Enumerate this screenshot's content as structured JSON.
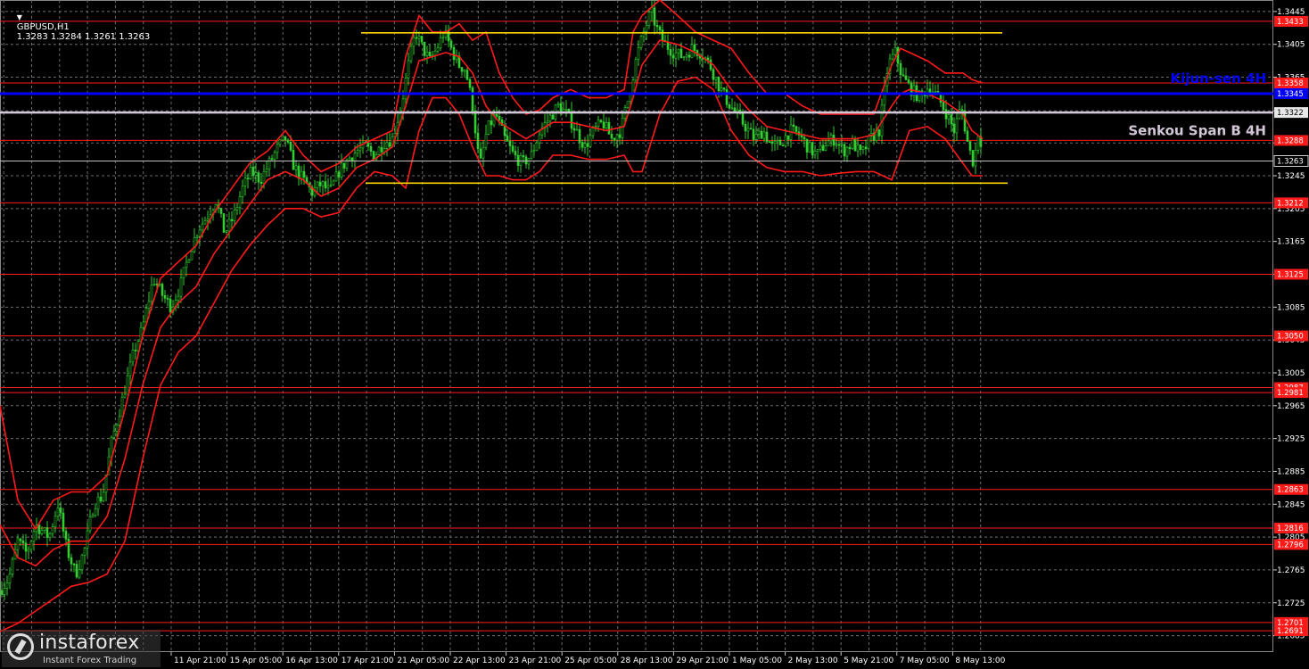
{
  "header": {
    "symbol": "GBPUSD,H1",
    "ohlc": "1.3283 1.3284 1.3261 1.3263"
  },
  "watermark": {
    "brand": "instaforex",
    "subtitle": "Instant Forex Trading"
  },
  "colors": {
    "background": "#000000",
    "grid": "#6d6d6d",
    "bull": "#32cd32",
    "bear": "#32cd32",
    "level": "#ff1a1a",
    "channel": "#ffd700",
    "kijun": "#0000ff",
    "senkou": "#d3c6d6",
    "axis_text": "#ffffff"
  },
  "chart_data": {
    "type": "candlestick",
    "symbol": "GBPUSD",
    "timeframe": "H1",
    "ylim": [
      1.2665,
      1.3459
    ],
    "grid": true,
    "y_ticks": [
      "1.3445",
      "1.3405",
      "1.3365",
      "1.3324",
      "1.3285",
      "1.3245",
      "1.3205",
      "1.3165",
      "1.3125",
      "1.3085",
      "1.3045",
      "1.3005",
      "1.2965",
      "1.2925",
      "1.2885",
      "1.2845",
      "1.2805",
      "1.2765",
      "1.2725",
      "1.2685"
    ],
    "x_ticks": [
      "11 Apr 21:00",
      "15 Apr 05:00",
      "16 Apr 13:00",
      "17 Apr 21:00",
      "21 Apr 05:00",
      "22 Apr 13:00",
      "23 Apr 21:00",
      "25 Apr 05:00",
      "28 Apr 13:00",
      "29 Apr 21:00",
      "1 May 05:00",
      "2 May 13:00",
      "5 May 21:00",
      "7 May 05:00",
      "8 May 13:00"
    ],
    "price_levels": [
      {
        "label": "1.3433",
        "value": 1.3433
      },
      {
        "label": "1.3358",
        "value": 1.3358
      },
      {
        "label": "1.3288",
        "value": 1.3288
      },
      {
        "label": "1.3212",
        "value": 1.3212
      },
      {
        "label": "1.3125",
        "value": 1.3125
      },
      {
        "label": "1.3050",
        "value": 1.305
      },
      {
        "label": "1.2987",
        "value": 1.2987
      },
      {
        "label": "1.2981",
        "value": 1.2981
      },
      {
        "label": "1.2863",
        "value": 1.2863
      },
      {
        "label": "1.2816",
        "value": 1.2816
      },
      {
        "label": "1.2796",
        "value": 1.2796
      },
      {
        "label": "1.2701",
        "value": 1.2701
      },
      {
        "label": "1.2691",
        "value": 1.2691
      }
    ],
    "current_price": {
      "label": "1.3263",
      "value": 1.3263
    },
    "kijun": {
      "name": "Kijun-sen 4H",
      "value": 1.3345,
      "label": "1.3345"
    },
    "senkou": {
      "name": "Senkou Span B 4H",
      "value": 1.3322,
      "label": "1.3322"
    },
    "channel": {
      "top": 1.3419,
      "bottom": 1.3236
    },
    "price_path": [
      [
        0,
        1.274
      ],
      [
        10,
        1.2755
      ],
      [
        20,
        1.28
      ],
      [
        30,
        1.2785
      ],
      [
        40,
        1.282
      ],
      [
        55,
        1.2805
      ],
      [
        65,
        1.2845
      ],
      [
        75,
        1.279
      ],
      [
        85,
        1.276
      ],
      [
        95,
        1.279
      ],
      [
        105,
        1.2845
      ],
      [
        115,
        1.2855
      ],
      [
        125,
        1.292
      ],
      [
        140,
        1.2985
      ],
      [
        150,
        1.303
      ],
      [
        160,
        1.306
      ],
      [
        172,
        1.312
      ],
      [
        182,
        1.31
      ],
      [
        192,
        1.3085
      ],
      [
        202,
        1.311
      ],
      [
        212,
        1.315
      ],
      [
        222,
        1.318
      ],
      [
        232,
        1.3195
      ],
      [
        242,
        1.3215
      ],
      [
        252,
        1.3175
      ],
      [
        262,
        1.3195
      ],
      [
        272,
        1.323
      ],
      [
        282,
        1.325
      ],
      [
        292,
        1.324
      ],
      [
        302,
        1.326
      ],
      [
        312,
        1.328
      ],
      [
        320,
        1.329
      ],
      [
        330,
        1.3255
      ],
      [
        340,
        1.324
      ],
      [
        350,
        1.3225
      ],
      [
        360,
        1.3235
      ],
      [
        370,
        1.3225
      ],
      [
        380,
        1.325
      ],
      [
        390,
        1.3265
      ],
      [
        400,
        1.3275
      ],
      [
        410,
        1.328
      ],
      [
        420,
        1.327
      ],
      [
        430,
        1.3285
      ],
      [
        440,
        1.329
      ],
      [
        450,
        1.333
      ],
      [
        458,
        1.338
      ],
      [
        466,
        1.342
      ],
      [
        474,
        1.34
      ],
      [
        482,
        1.3385
      ],
      [
        490,
        1.34
      ],
      [
        498,
        1.342
      ],
      [
        506,
        1.34
      ],
      [
        514,
        1.338
      ],
      [
        522,
        1.3375
      ],
      [
        530,
        1.333
      ],
      [
        538,
        1.3255
      ],
      [
        546,
        1.33
      ],
      [
        556,
        1.332
      ],
      [
        566,
        1.329
      ],
      [
        576,
        1.327
      ],
      [
        586,
        1.326
      ],
      [
        596,
        1.327
      ],
      [
        606,
        1.33
      ],
      [
        616,
        1.3315
      ],
      [
        626,
        1.333
      ],
      [
        636,
        1.332
      ],
      [
        646,
        1.33
      ],
      [
        656,
        1.328
      ],
      [
        666,
        1.33
      ],
      [
        676,
        1.331
      ],
      [
        686,
        1.329
      ],
      [
        696,
        1.33
      ],
      [
        706,
        1.3345
      ],
      [
        714,
        1.339
      ],
      [
        722,
        1.342
      ],
      [
        730,
        1.3445
      ],
      [
        738,
        1.342
      ],
      [
        746,
        1.3405
      ],
      [
        756,
        1.3395
      ],
      [
        766,
        1.339
      ],
      [
        776,
        1.34
      ],
      [
        786,
        1.3395
      ],
      [
        796,
        1.338
      ],
      [
        806,
        1.3355
      ],
      [
        816,
        1.3335
      ],
      [
        826,
        1.332
      ],
      [
        836,
        1.3305
      ],
      [
        846,
        1.329
      ],
      [
        856,
        1.33
      ],
      [
        866,
        1.328
      ],
      [
        876,
        1.3285
      ],
      [
        886,
        1.33
      ],
      [
        896,
        1.3295
      ],
      [
        906,
        1.328
      ],
      [
        916,
        1.327
      ],
      [
        926,
        1.3285
      ],
      [
        936,
        1.329
      ],
      [
        946,
        1.3275
      ],
      [
        956,
        1.3285
      ],
      [
        966,
        1.327
      ],
      [
        976,
        1.329
      ],
      [
        986,
        1.33
      ],
      [
        996,
        1.338
      ],
      [
        1004,
        1.3395
      ],
      [
        1012,
        1.3365
      ],
      [
        1022,
        1.335
      ],
      [
        1032,
        1.334
      ],
      [
        1042,
        1.3355
      ],
      [
        1052,
        1.334
      ],
      [
        1062,
        1.332
      ],
      [
        1070,
        1.33
      ],
      [
        1078,
        1.333
      ],
      [
        1086,
        1.328
      ],
      [
        1092,
        1.326
      ],
      [
        1098,
        1.3305
      ],
      [
        1102,
        1.327
      ]
    ],
    "envelope_upper": [
      [
        0,
        1.2965
      ],
      [
        20,
        1.285
      ],
      [
        40,
        1.2815
      ],
      [
        60,
        1.285
      ],
      [
        80,
        1.286
      ],
      [
        100,
        1.286
      ],
      [
        120,
        1.288
      ],
      [
        140,
        1.296
      ],
      [
        160,
        1.305
      ],
      [
        180,
        1.312
      ],
      [
        200,
        1.314
      ],
      [
        220,
        1.316
      ],
      [
        240,
        1.32
      ],
      [
        260,
        1.323
      ],
      [
        280,
        1.326
      ],
      [
        300,
        1.3275
      ],
      [
        320,
        1.33
      ],
      [
        340,
        1.327
      ],
      [
        360,
        1.325
      ],
      [
        380,
        1.326
      ],
      [
        400,
        1.328
      ],
      [
        420,
        1.329
      ],
      [
        440,
        1.33
      ],
      [
        455,
        1.339
      ],
      [
        470,
        1.344
      ],
      [
        485,
        1.342
      ],
      [
        500,
        1.342
      ],
      [
        515,
        1.343
      ],
      [
        530,
        1.341
      ],
      [
        545,
        1.342
      ],
      [
        560,
        1.337
      ],
      [
        575,
        1.334
      ],
      [
        590,
        1.332
      ],
      [
        605,
        1.3325
      ],
      [
        620,
        1.334
      ],
      [
        640,
        1.335
      ],
      [
        660,
        1.334
      ],
      [
        680,
        1.334
      ],
      [
        700,
        1.335
      ],
      [
        710,
        1.342
      ],
      [
        720,
        1.344
      ],
      [
        740,
        1.3459
      ],
      [
        760,
        1.344
      ],
      [
        780,
        1.342
      ],
      [
        800,
        1.341
      ],
      [
        820,
        1.34
      ],
      [
        840,
        1.337
      ],
      [
        860,
        1.3345
      ],
      [
        880,
        1.3345
      ],
      [
        900,
        1.333
      ],
      [
        920,
        1.332
      ],
      [
        940,
        1.332
      ],
      [
        960,
        1.332
      ],
      [
        980,
        1.332
      ],
      [
        1000,
        1.338
      ],
      [
        1010,
        1.34
      ],
      [
        1020,
        1.3395
      ],
      [
        1040,
        1.3385
      ],
      [
        1060,
        1.337
      ],
      [
        1080,
        1.337
      ],
      [
        1090,
        1.3362
      ],
      [
        1102,
        1.3358
      ]
    ],
    "envelope_middle": [
      [
        0,
        1.282
      ],
      [
        20,
        1.278
      ],
      [
        40,
        1.277
      ],
      [
        60,
        1.279
      ],
      [
        80,
        1.28
      ],
      [
        100,
        1.28
      ],
      [
        120,
        1.283
      ],
      [
        140,
        1.29
      ],
      [
        160,
        1.299
      ],
      [
        180,
        1.306
      ],
      [
        200,
        1.309
      ],
      [
        220,
        1.311
      ],
      [
        240,
        1.315
      ],
      [
        260,
        1.318
      ],
      [
        280,
        1.321
      ],
      [
        300,
        1.324
      ],
      [
        320,
        1.325
      ],
      [
        340,
        1.324
      ],
      [
        360,
        1.322
      ],
      [
        380,
        1.323
      ],
      [
        400,
        1.3255
      ],
      [
        420,
        1.3265
      ],
      [
        440,
        1.328
      ],
      [
        455,
        1.333
      ],
      [
        470,
        1.3385
      ],
      [
        485,
        1.339
      ],
      [
        500,
        1.3395
      ],
      [
        515,
        1.339
      ],
      [
        530,
        1.337
      ],
      [
        545,
        1.333
      ],
      [
        560,
        1.331
      ],
      [
        575,
        1.33
      ],
      [
        590,
        1.329
      ],
      [
        605,
        1.33
      ],
      [
        620,
        1.331
      ],
      [
        640,
        1.331
      ],
      [
        660,
        1.3305
      ],
      [
        680,
        1.33
      ],
      [
        700,
        1.3305
      ],
      [
        710,
        1.334
      ],
      [
        720,
        1.338
      ],
      [
        740,
        1.341
      ],
      [
        760,
        1.3405
      ],
      [
        780,
        1.3395
      ],
      [
        800,
        1.338
      ],
      [
        820,
        1.335
      ],
      [
        840,
        1.3325
      ],
      [
        860,
        1.3305
      ],
      [
        880,
        1.33
      ],
      [
        900,
        1.3295
      ],
      [
        920,
        1.329
      ],
      [
        940,
        1.329
      ],
      [
        960,
        1.329
      ],
      [
        980,
        1.3295
      ],
      [
        1000,
        1.333
      ],
      [
        1010,
        1.3345
      ],
      [
        1020,
        1.335
      ],
      [
        1040,
        1.3345
      ],
      [
        1060,
        1.3335
      ],
      [
        1080,
        1.332
      ],
      [
        1090,
        1.33
      ],
      [
        1102,
        1.329
      ]
    ],
    "envelope_lower": [
      [
        0,
        1.269
      ],
      [
        20,
        1.27
      ],
      [
        40,
        1.2715
      ],
      [
        60,
        1.273
      ],
      [
        80,
        1.2745
      ],
      [
        100,
        1.275
      ],
      [
        120,
        1.276
      ],
      [
        140,
        1.28
      ],
      [
        160,
        1.29
      ],
      [
        180,
        1.299
      ],
      [
        200,
        1.303
      ],
      [
        220,
        1.305
      ],
      [
        240,
        1.309
      ],
      [
        260,
        1.313
      ],
      [
        280,
        1.316
      ],
      [
        300,
        1.3185
      ],
      [
        320,
        1.3205
      ],
      [
        340,
        1.3205
      ],
      [
        360,
        1.3195
      ],
      [
        380,
        1.32
      ],
      [
        400,
        1.323
      ],
      [
        420,
        1.325
      ],
      [
        440,
        1.3245
      ],
      [
        455,
        1.323
      ],
      [
        470,
        1.33
      ],
      [
        485,
        1.334
      ],
      [
        500,
        1.334
      ],
      [
        515,
        1.332
      ],
      [
        530,
        1.328
      ],
      [
        545,
        1.3245
      ],
      [
        560,
        1.3245
      ],
      [
        575,
        1.324
      ],
      [
        590,
        1.324
      ],
      [
        605,
        1.325
      ],
      [
        620,
        1.327
      ],
      [
        640,
        1.327
      ],
      [
        660,
        1.3265
      ],
      [
        680,
        1.3265
      ],
      [
        700,
        1.327
      ],
      [
        710,
        1.325
      ],
      [
        720,
        1.325
      ],
      [
        740,
        1.332
      ],
      [
        760,
        1.336
      ],
      [
        780,
        1.3365
      ],
      [
        800,
        1.335
      ],
      [
        820,
        1.33
      ],
      [
        840,
        1.327
      ],
      [
        860,
        1.3255
      ],
      [
        880,
        1.325
      ],
      [
        900,
        1.325
      ],
      [
        920,
        1.3245
      ],
      [
        940,
        1.3248
      ],
      [
        960,
        1.325
      ],
      [
        980,
        1.325
      ],
      [
        1000,
        1.324
      ],
      [
        1010,
        1.327
      ],
      [
        1020,
        1.33
      ],
      [
        1040,
        1.3305
      ],
      [
        1060,
        1.329
      ],
      [
        1080,
        1.326
      ],
      [
        1090,
        1.3245
      ],
      [
        1102,
        1.3245
      ]
    ]
  }
}
